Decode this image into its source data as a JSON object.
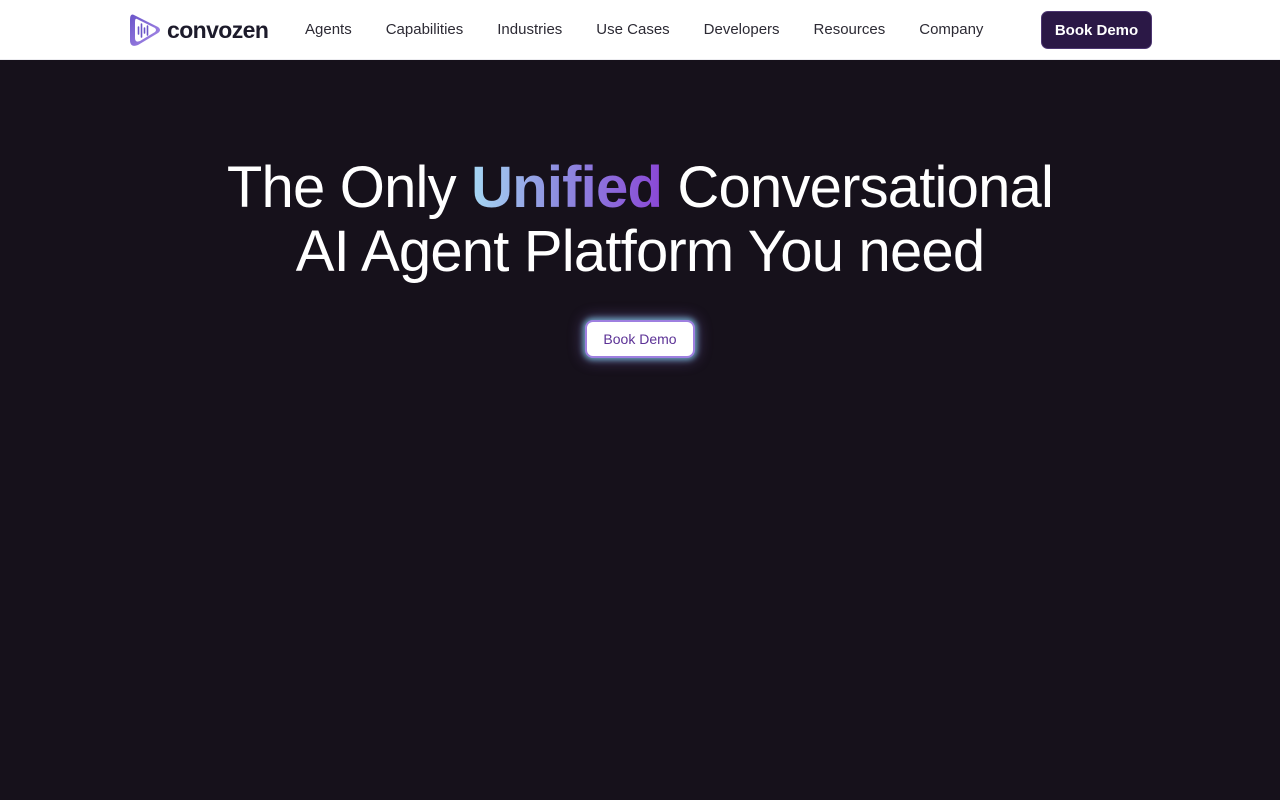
{
  "brand": {
    "name": "convozen",
    "logo_icon": "waveform-bubble-icon",
    "colors": {
      "primary": "#2b1846",
      "accent_start": "#a6d8f4",
      "accent_end": "#8a47d6",
      "background": "#16111b"
    }
  },
  "nav": {
    "items": [
      {
        "label": "Agents"
      },
      {
        "label": "Capabilities"
      },
      {
        "label": "Industries"
      },
      {
        "label": "Use Cases"
      },
      {
        "label": "Developers"
      },
      {
        "label": "Resources"
      },
      {
        "label": "Company"
      }
    ],
    "cta_label": "Book Demo"
  },
  "hero": {
    "headline_prefix": "The Only ",
    "headline_accent": "Unified",
    "headline_suffix": " Conversational",
    "headline_line2": "AI Agent Platform You need",
    "cta_label": "Book Demo"
  }
}
